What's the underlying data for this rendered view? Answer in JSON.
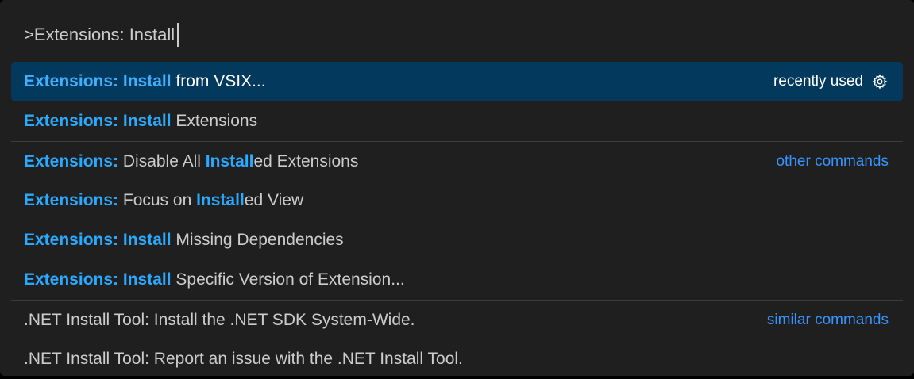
{
  "input": {
    "value": ">Extensions: Install"
  },
  "items": [
    {
      "hl": "Extensions: Install",
      "rest": " from VSIX...",
      "right": "recently used",
      "selected": true
    },
    {
      "hl": "Extensions: Install",
      "rest": " Extensions"
    },
    {
      "parts": [
        [
          "hl",
          "Extensions:"
        ],
        [
          "txt",
          " Disable All "
        ],
        [
          "hl",
          "Install"
        ],
        [
          "txt",
          "ed Extensions"
        ]
      ],
      "group": "other commands"
    },
    {
      "parts": [
        [
          "hl",
          "Extensions:"
        ],
        [
          "txt",
          " Focus on "
        ],
        [
          "hl",
          "Install"
        ],
        [
          "txt",
          "ed View"
        ]
      ]
    },
    {
      "hl": "Extensions: Install",
      "rest": " Missing Dependencies"
    },
    {
      "hl": "Extensions: Install",
      "rest": " Specific Version of Extension..."
    },
    {
      "rest": ".NET Install Tool: Install the .NET SDK System-Wide.",
      "group": "similar commands"
    },
    {
      "rest": ".NET Install Tool: Report an issue with the .NET Install Tool."
    }
  ],
  "icons": {
    "configure": "gear-icon"
  },
  "colors": {
    "background": "#1f1f1f",
    "selected": "#04395e",
    "highlight": "#2aaaff",
    "group_label": "#3794ff",
    "text": "#cccccc"
  }
}
